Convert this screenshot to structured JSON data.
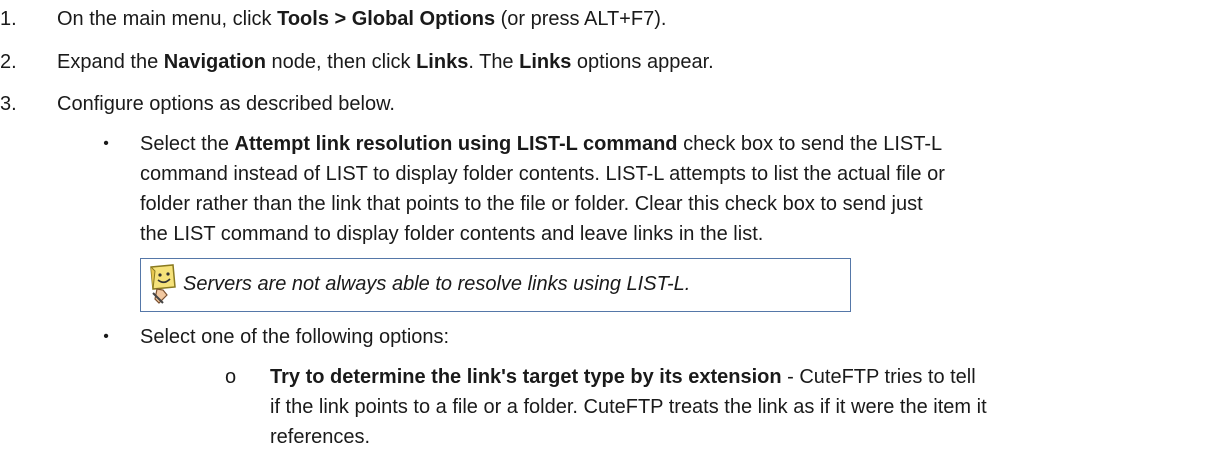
{
  "steps": [
    {
      "num": "1.",
      "pre": "On the main menu, click ",
      "bold": "Tools > Global Options",
      "post": " (or press ALT+F7)."
    },
    {
      "num": "2.",
      "pre": "Expand the ",
      "bold1": "Navigation",
      "mid1": " node, then click ",
      "bold2": "Links",
      "mid2": ". The ",
      "bold3": "Links",
      "post": " options appear."
    },
    {
      "num": "3.",
      "text": "Configure options as described below."
    }
  ],
  "bullet1": {
    "pre": "Select the ",
    "bold": "Attempt link resolution using LIST-L command",
    "line1_post": " check box to send the LIST-L",
    "line2": "command instead of LIST to display folder contents. LIST-L attempts to list the actual file or",
    "line3": "folder rather than the link that points to the file or folder. Clear this check box to send just",
    "line4": "the LIST command to display folder contents and leave links in the list."
  },
  "note": {
    "text": "Servers are not always able to resolve links using LIST-L.",
    "icon": "note-icon"
  },
  "bullet2": {
    "text": "Select one of the following options:"
  },
  "sub_option": {
    "marker": "o",
    "bold": "Try to determine the link's target type by its extension",
    "line1_post": " - CuteFTP tries to tell",
    "line2": "if the link points to a file or a folder. CuteFTP treats the link as if it were the item it",
    "line3": "references."
  },
  "bullet_char": "•"
}
